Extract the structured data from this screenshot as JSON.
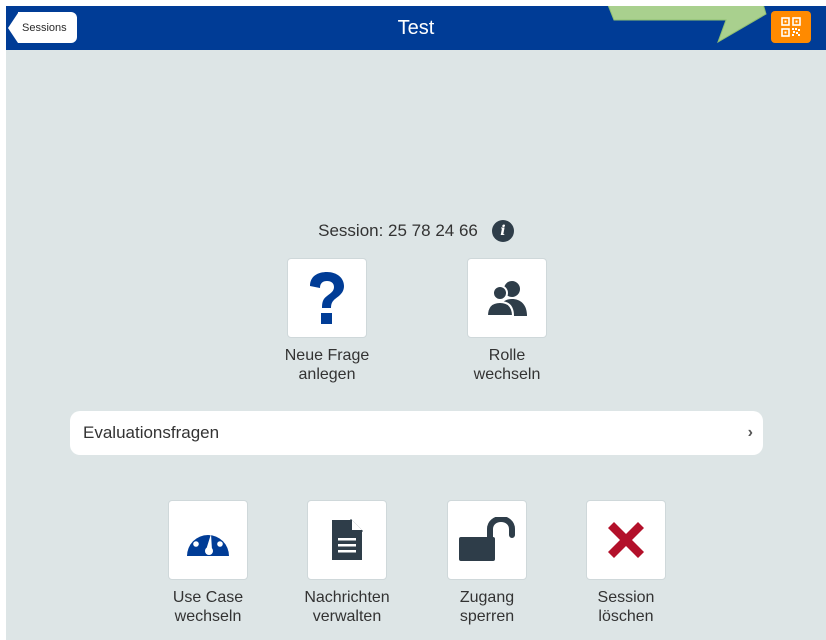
{
  "header": {
    "back_label": "Sessions",
    "title": "Test",
    "qr_icon": "qr-code-icon"
  },
  "session": {
    "label": "Session: 25 78 24 66",
    "info_icon": "info-icon"
  },
  "tiles_top": [
    {
      "label_line1": "Neue Frage",
      "label_line2": "anlegen",
      "icon": "question-mark-icon"
    },
    {
      "label_line1": "Rolle",
      "label_line2": "wechseln",
      "icon": "users-icon"
    }
  ],
  "evaluation": {
    "label": "Evaluationsfragen",
    "chevron": "›"
  },
  "tiles_bottom": [
    {
      "label_line1": "Use Case",
      "label_line2": "wechseln",
      "icon": "dashboard-icon"
    },
    {
      "label_line1": "Nachrichten",
      "label_line2": "verwalten",
      "icon": "document-icon"
    },
    {
      "label_line1": "Zugang",
      "label_line2": "sperren",
      "icon": "unlock-icon"
    },
    {
      "label_line1": "Session",
      "label_line2": "löschen",
      "icon": "delete-x-icon"
    }
  ],
  "colors": {
    "header_bg": "#003c96",
    "page_bg": "#dde5e6",
    "accent_orange": "#ff8a00",
    "icon_blue": "#003c96",
    "icon_dark": "#2e3d49",
    "delete_red": "#b3102a",
    "arrow_green": "#a9d08e"
  }
}
